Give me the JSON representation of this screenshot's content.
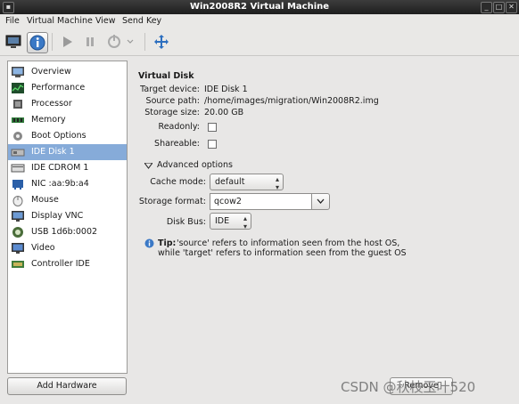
{
  "window": {
    "title": "Win2008R2 Virtual Machine"
  },
  "menubar": [
    {
      "label": "File"
    },
    {
      "label": "Virtual Machine"
    },
    {
      "label": "View"
    },
    {
      "label": "Send Key"
    }
  ],
  "toolbar": {
    "buttons": [
      "console-monitor-icon",
      "details-info-icon",
      "run-icon",
      "pause-icon",
      "shutdown-icon",
      "shutdown-menu-icon",
      "fullscreen-icon"
    ]
  },
  "sidebar": {
    "items": [
      {
        "label": "Overview",
        "icon": "overview-icon"
      },
      {
        "label": "Performance",
        "icon": "performance-icon"
      },
      {
        "label": "Processor",
        "icon": "processor-icon"
      },
      {
        "label": "Memory",
        "icon": "memory-icon"
      },
      {
        "label": "Boot Options",
        "icon": "boot-options-icon"
      },
      {
        "label": "IDE Disk 1",
        "icon": "disk-icon",
        "selected": true
      },
      {
        "label": "IDE CDROM 1",
        "icon": "cdrom-icon"
      },
      {
        "label": "NIC :aa:9b:a4",
        "icon": "nic-icon"
      },
      {
        "label": "Mouse",
        "icon": "mouse-icon"
      },
      {
        "label": "Display VNC",
        "icon": "display-icon"
      },
      {
        "label": "USB 1d6b:0002",
        "icon": "usb-icon"
      },
      {
        "label": "Video",
        "icon": "video-icon"
      },
      {
        "label": "Controller IDE",
        "icon": "controller-icon"
      }
    ],
    "add_hardware": "Add Hardware"
  },
  "disk": {
    "heading": "Virtual Disk",
    "target_device_label": "Target device:",
    "target_device": "IDE Disk 1",
    "source_path_label": "Source path:",
    "source_path": "/home/images/migration/Win2008R2.img",
    "storage_size_label": "Storage size:",
    "storage_size": "20.00 GB",
    "readonly_label": "Readonly:",
    "readonly": false,
    "shareable_label": "Shareable:",
    "shareable": false
  },
  "advanced": {
    "toggle_label": "Advanced options",
    "cache_mode_label": "Cache mode:",
    "cache_mode": "default",
    "storage_format_label": "Storage format:",
    "storage_format": "qcow2",
    "disk_bus_label": "Disk Bus:",
    "disk_bus": "IDE"
  },
  "tip": {
    "bold": "Tip:",
    "line1": "'source' refers to information seen from the host OS,",
    "line2": "while 'target' refers to information seen from the guest OS"
  },
  "buttons": {
    "remove": "Remove"
  },
  "watermark": "CSDN @秋枝玉叶520"
}
